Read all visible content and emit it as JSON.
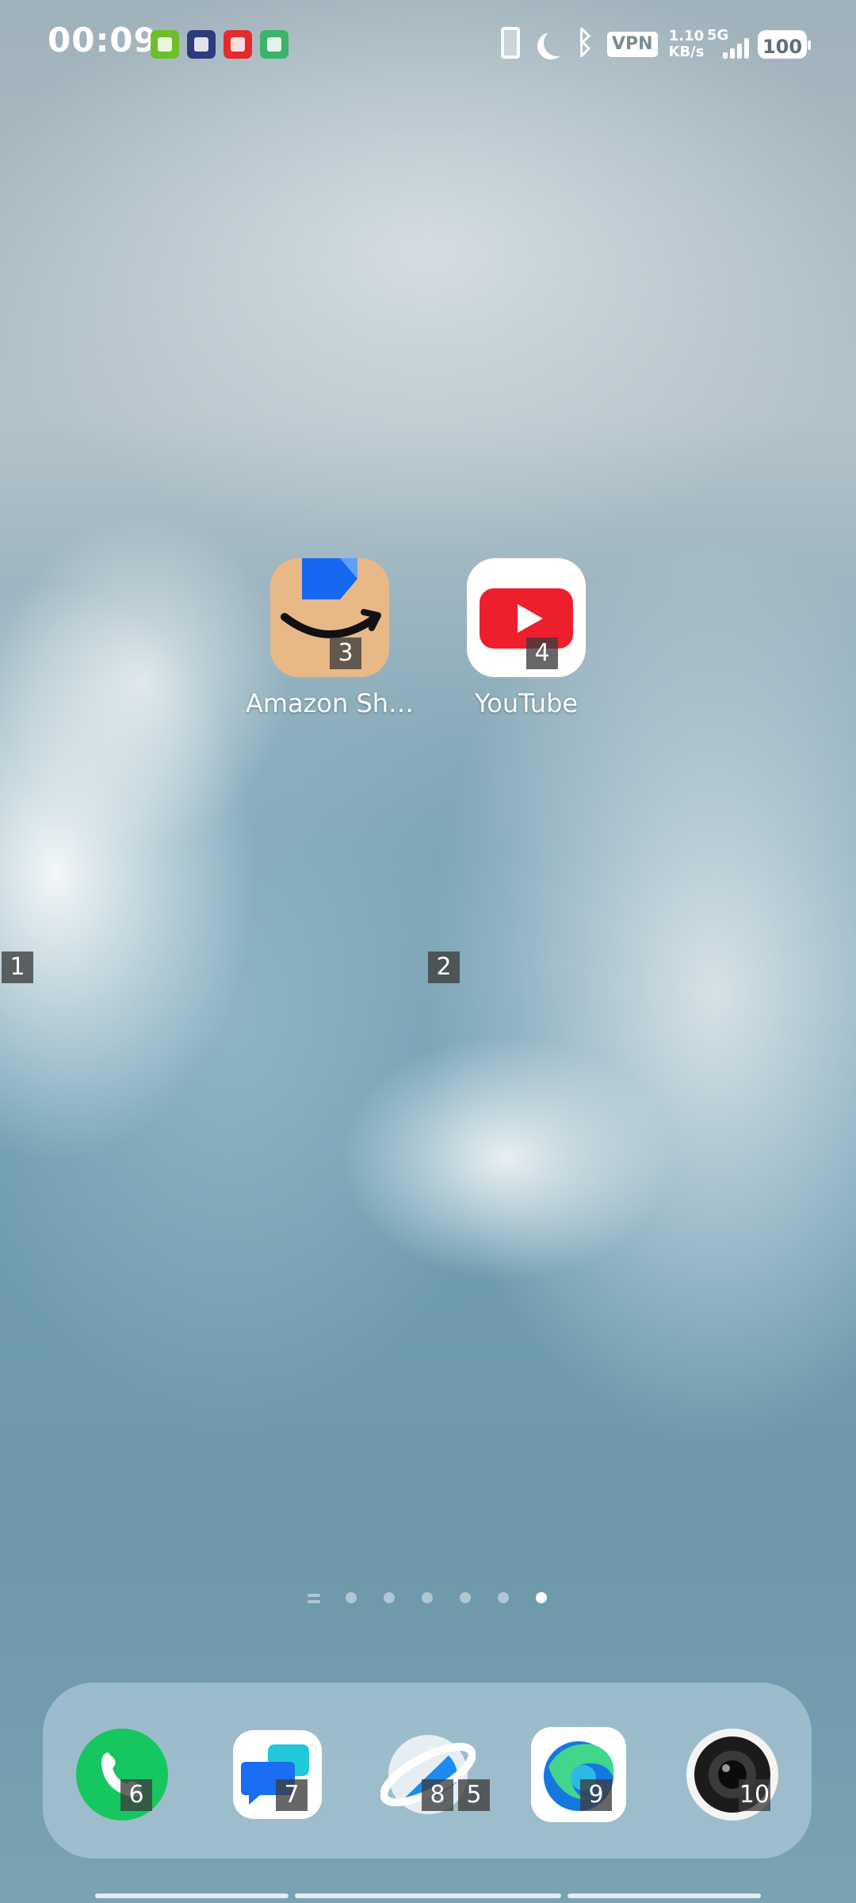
{
  "status_bar": {
    "time": "00:09",
    "network_speed_value": "1.10",
    "network_speed_unit": "KB/s",
    "network_type": "5G",
    "vpn_label": "VPN",
    "battery": "100"
  },
  "home": {
    "apps": [
      {
        "label": "Amazon Sh…",
        "tag": "3"
      },
      {
        "label": "YouTube",
        "tag": "4"
      }
    ],
    "markers": [
      "1",
      "2"
    ]
  },
  "pager": {
    "count": 6,
    "active_index": 5
  },
  "dock": {
    "apps": [
      {
        "name": "Phone",
        "tag": "6"
      },
      {
        "name": "Messages",
        "tag": "7"
      },
      {
        "name": "Browser",
        "tag": "8",
        "extra_tag": "5"
      },
      {
        "name": "Edge",
        "tag": "9"
      },
      {
        "name": "Camera",
        "tag": "10"
      }
    ]
  },
  "colors": {
    "phone_green": "#16c75f",
    "youtube_red": "#ee1f2d",
    "amazon_tan": "#e8b987",
    "amazon_blue": "#1668f0"
  }
}
